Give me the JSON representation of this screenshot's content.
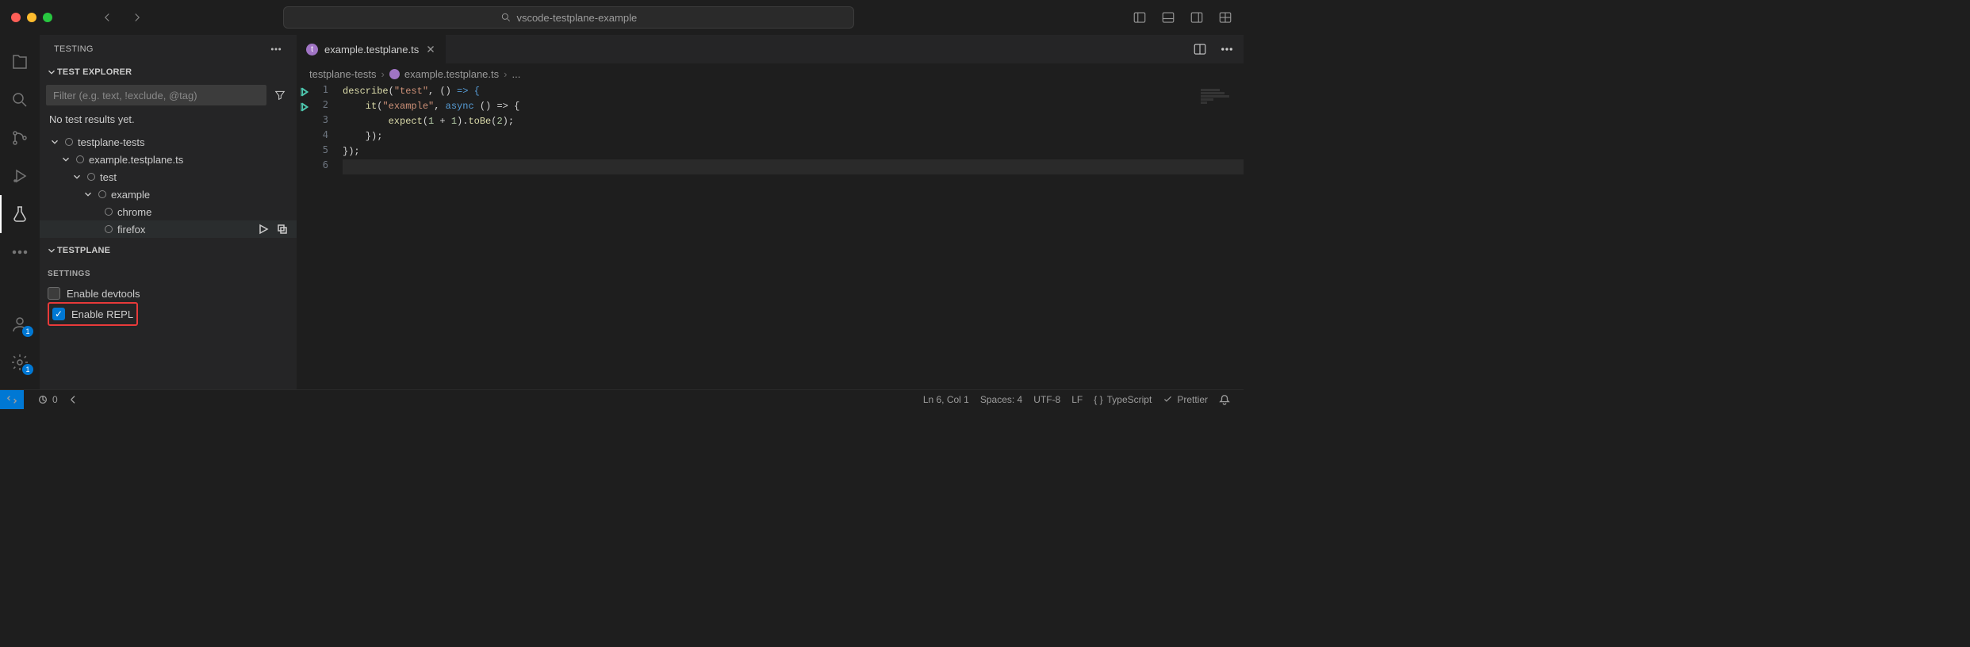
{
  "window": {
    "title": "vscode-testplane-example"
  },
  "activity": {
    "accountBadge": "1",
    "settingsBadge": "1"
  },
  "sidebar": {
    "title": "TESTING",
    "section1": "TEST EXPLORER",
    "filterPlaceholder": "Filter (e.g. text, !exclude, @tag)",
    "noResults": "No test results yet.",
    "tree": {
      "root": "testplane-tests",
      "file": "example.testplane.ts",
      "describe": "test",
      "it": "example",
      "browser1": "chrome",
      "browser2": "firefox"
    },
    "section2": "TESTPLANE",
    "settingsHeading": "SETTINGS",
    "cb1": "Enable devtools",
    "cb2": "Enable REPL"
  },
  "tab": {
    "label": "example.testplane.ts"
  },
  "breadcrumbs": {
    "a": "testplane-tests",
    "b": "example.testplane.ts",
    "c": "..."
  },
  "code": {
    "l1a": "describe",
    "l1b": "(",
    "l1c": "\"test\"",
    "l1d": ", ",
    "l1e": "()",
    "l1f": " => {",
    "l2a": "    it",
    "l2b": "(",
    "l2c": "\"example\"",
    "l2d": ", ",
    "l2e": "async",
    "l2f": " () => {",
    "l3a": "        expect",
    "l3b": "(",
    "l3c": "1",
    "l3d": " + ",
    "l3e": "1",
    "l3f": ").",
    "l3g": "toBe",
    "l3h": "(",
    "l3i": "2",
    "l3j": ");",
    "l4": "    });",
    "l5": "});"
  },
  "status": {
    "ports": "0",
    "ln": "Ln 6, Col 1",
    "spaces": "Spaces: 4",
    "enc": "UTF-8",
    "eol": "LF",
    "lang": "TypeScript",
    "prettier": "Prettier"
  }
}
